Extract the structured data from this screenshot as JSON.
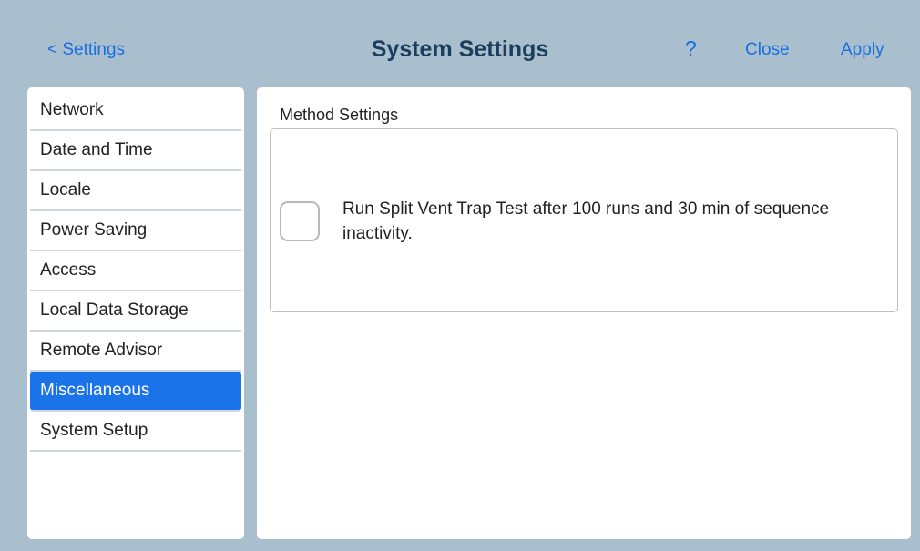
{
  "header": {
    "back_label": "< Settings",
    "title": "System Settings",
    "help_label": "?",
    "close_label": "Close",
    "apply_label": "Apply"
  },
  "sidebar": {
    "items": [
      {
        "label": "Network",
        "selected": false
      },
      {
        "label": "Date and Time",
        "selected": false
      },
      {
        "label": "Locale",
        "selected": false
      },
      {
        "label": "Power Saving",
        "selected": false
      },
      {
        "label": "Access",
        "selected": false
      },
      {
        "label": "Local Data Storage",
        "selected": false
      },
      {
        "label": "Remote Advisor",
        "selected": false
      },
      {
        "label": "Miscellaneous",
        "selected": true
      },
      {
        "label": "System Setup",
        "selected": false
      }
    ]
  },
  "main": {
    "section_title": "Method Settings",
    "option": {
      "label": "Run Split Vent Trap Test after 100 runs and 30 min of sequence inactivity.",
      "checked": false
    }
  },
  "colors": {
    "background": "#a9bfcd",
    "accent": "#1a73e8",
    "link": "#1a6fe0",
    "title": "#1c3d5e"
  }
}
